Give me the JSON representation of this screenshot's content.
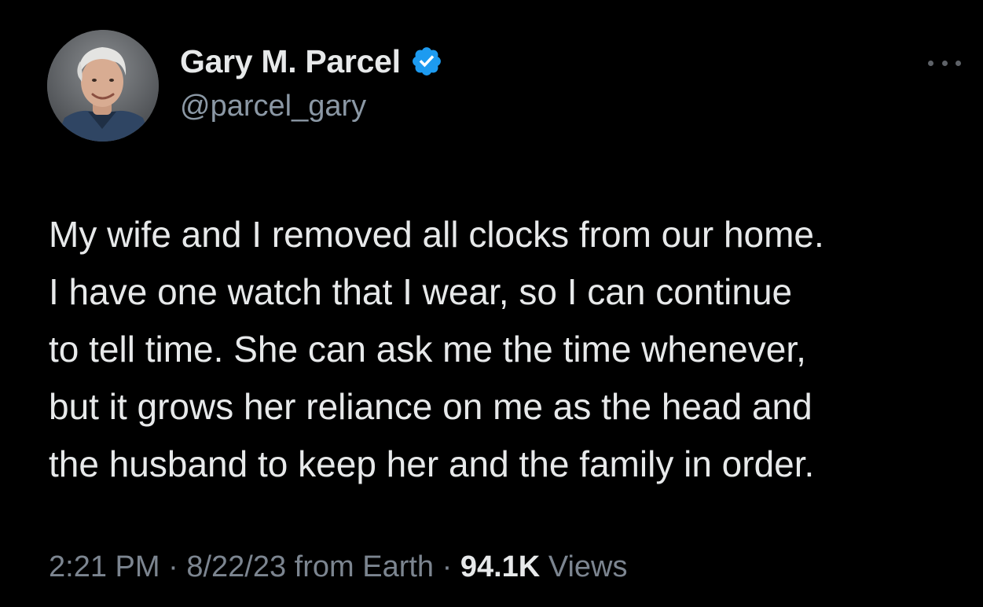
{
  "author": {
    "display_name": "Gary M. Parcel",
    "handle": "@parcel_gary",
    "verified": true,
    "verified_icon": "verified-badge-icon",
    "verified_color": "#1d9bf0"
  },
  "tweet": {
    "lines": [
      "My wife and I removed all clocks from our home.",
      "I have one watch that I wear, so I can continue",
      "to tell time. She can ask me the time whenever,",
      "but it grows her reliance on me as the head and",
      "the husband to keep her and the family in order."
    ]
  },
  "meta": {
    "time": "2:21 PM",
    "separator": "·",
    "date": "8/22/23",
    "source": "from Earth",
    "views_count": "94.1K",
    "views_label": "Views"
  },
  "colors": {
    "background": "#000000",
    "text_primary": "#e7e9ea",
    "text_secondary": "#8b98a5",
    "accent": "#1d9bf0"
  },
  "icons": {
    "more": "more-options-icon"
  }
}
